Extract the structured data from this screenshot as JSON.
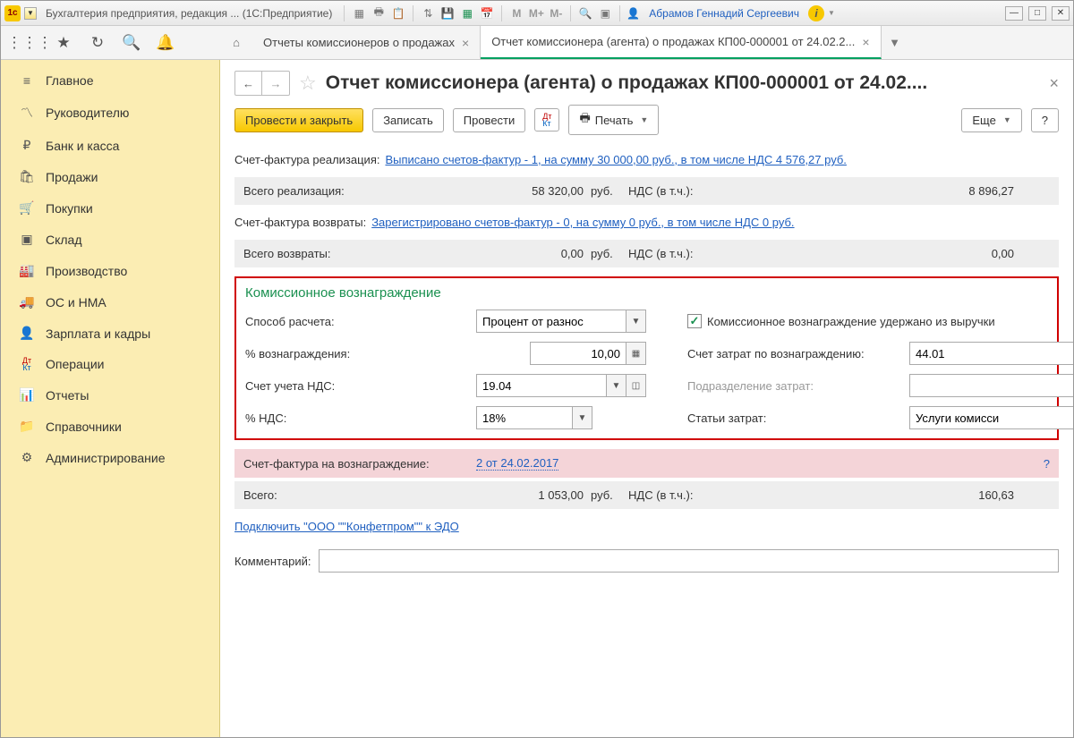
{
  "titlebar": {
    "app_title": "Бухгалтерия предприятия, редакция ... (1С:Предприятие)",
    "user": "Абрамов Геннадий Сергеевич",
    "m": "M",
    "mp": "M+",
    "mm": "M-"
  },
  "tabs": {
    "t1": "Отчеты комиссионеров о продажах",
    "t2": "Отчет комиссионера (агента) о продажах КП00-000001 от 24.02.2..."
  },
  "sidebar": {
    "items": [
      "Главное",
      "Руководителю",
      "Банк и касса",
      "Продажи",
      "Покупки",
      "Склад",
      "Производство",
      "ОС и НМА",
      "Зарплата и кадры",
      "Операции",
      "Отчеты",
      "Справочники",
      "Администрирование"
    ]
  },
  "page": {
    "title": "Отчет комиссионера (агента) о продажах КП00-000001 от 24.02....",
    "cmd": {
      "post_close": "Провести и закрыть",
      "save": "Записать",
      "post": "Провести",
      "print": "Печать",
      "more": "Еще"
    },
    "invoice_sales_lbl": "Счет-фактура реализация:",
    "invoice_sales_link": "Выписано счетов-фактур - 1, на сумму 30 000,00 руб., в том числе НДС 4 576,27 руб.",
    "total_sales_lbl": "Всего реализация:",
    "total_sales_val": "58 320,00",
    "currency": "руб.",
    "vat_incl_lbl": "НДС (в т.ч.):",
    "total_sales_vat": "8 896,27",
    "invoice_ret_lbl": "Счет-фактура возвраты:",
    "invoice_ret_link": "Зарегистрировано счетов-фактур - 0, на сумму 0 руб., в том числе НДС 0 руб.",
    "total_ret_lbl": "Всего возвраты:",
    "total_ret_val": "0,00",
    "total_ret_vat": "0,00",
    "commission": {
      "title": "Комиссионное вознаграждение",
      "calc_lbl": "Способ расчета:",
      "calc_val": "Процент от разнос",
      "withheld": "Комиссионное вознаграждение удержано из выручки",
      "pct_lbl": "% вознаграждения:",
      "pct_val": "10,00",
      "exp_acc_lbl": "Счет затрат по вознаграждению:",
      "exp_acc_val": "44.01",
      "vat_acc_lbl": "Счет учета НДС:",
      "vat_acc_val": "19.04",
      "dept_lbl": "Подразделение затрат:",
      "dept_val": "",
      "vat_pct_lbl": "% НДС:",
      "vat_pct_val": "18%",
      "exp_item_lbl": "Статьи затрат:",
      "exp_item_val": "Услуги комисси"
    },
    "comm_invoice_lbl": "Счет-фактура на вознаграждение:",
    "comm_invoice_link": "2 от 24.02.2017",
    "total_lbl": "Всего:",
    "total_val": "1 053,00",
    "total_vat": "160,63",
    "edo_link": "Подключить \"ООО \"\"Конфетпром\"\" к ЭДО",
    "comment_lbl": "Комментарий:"
  }
}
